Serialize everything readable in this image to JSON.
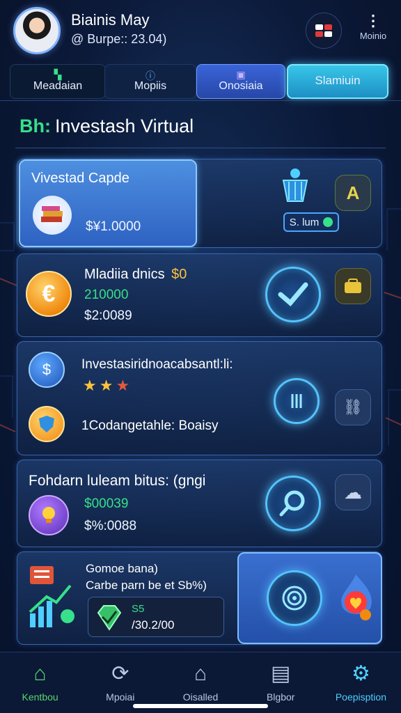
{
  "header": {
    "user_name": "Biainis May",
    "user_sub": "@ Burpe:: 23.04)",
    "more_label": "Moinio"
  },
  "tabs": [
    {
      "label": "Meadaian",
      "icon": "chart-icon"
    },
    {
      "label": "Mopiis",
      "icon": "info-icon"
    },
    {
      "label": "Onosiaia",
      "icon": "briefcase-icon"
    },
    {
      "label": "Slamiuin",
      "icon": ""
    }
  ],
  "section": {
    "prefix": "Bh:",
    "title": "Investash Virtual"
  },
  "cards": {
    "card1": {
      "title": "Vivestad Capde",
      "value": "$¥1.0000",
      "pill_value": "S. lum"
    },
    "card2": {
      "title": "Mladiia dnics",
      "title_amount": "$0",
      "line1": "210000",
      "line2": "$2:0089"
    },
    "card3": {
      "line1": "Investasiridnoacabsantl:li:",
      "line2": "1Codangetahle: Boaisy"
    },
    "card4": {
      "title": "Fohdarn luleam bitus: (gngi",
      "line1": "$00039",
      "line2": "$%:0088"
    },
    "card5": {
      "line1": "Gomoe bana)",
      "line2": "Carbe parn be et Sb%)",
      "reward1": "S5",
      "reward2": "/30.2/00"
    }
  },
  "nav": [
    {
      "label": "Kentbou",
      "icon": "home-icon"
    },
    {
      "label": "Mpoiai",
      "icon": "refresh-icon"
    },
    {
      "label": "Oisalled",
      "icon": "store-icon"
    },
    {
      "label": "Blgbor",
      "icon": "shop-icon"
    },
    {
      "label": "Poepisption",
      "icon": "gear-icon"
    }
  ],
  "colors": {
    "accent": "#37e08a",
    "primary": "#2e62c2",
    "highlight": "#4fcfff"
  }
}
